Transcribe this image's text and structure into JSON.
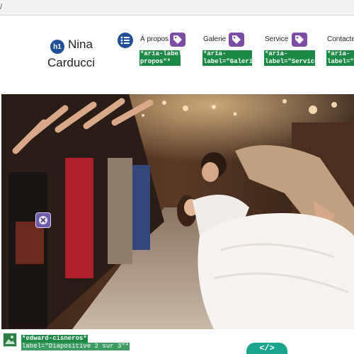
{
  "browser": {
    "url_fragment": "/"
  },
  "header": {
    "heading_badge": "h1",
    "brand_first": "Nina",
    "brand_last": "Carducci",
    "nav_items": [
      {
        "label": "À propos",
        "aria_note": "*aria-label=\"à\npropos\"*"
      },
      {
        "label": "Galerie",
        "aria_note": "*aria-\nlabel=\"Galerie\"*"
      },
      {
        "label": "Service",
        "aria_note": "*aria-\nlabel=\"Service\"*"
      },
      {
        "label": "Contacte",
        "aria_note": "*aria-\nlabel=\"Co"
      }
    ]
  },
  "hero": {
    "photo_credit": "*edward-cisneros*",
    "slide_label": "label=\"Diapositive 2 sur 3\"*"
  },
  "footer": {
    "code_button_label": "</>"
  },
  "colors": {
    "accent_blue": "#1f4f96",
    "tag_purple": "#7b4ea3",
    "annotation_green": "#1c8a46",
    "code_teal": "#18a58c"
  },
  "icons": [
    "list-icon",
    "tag-icon",
    "close-icon",
    "image-icon",
    "code-icon"
  ]
}
